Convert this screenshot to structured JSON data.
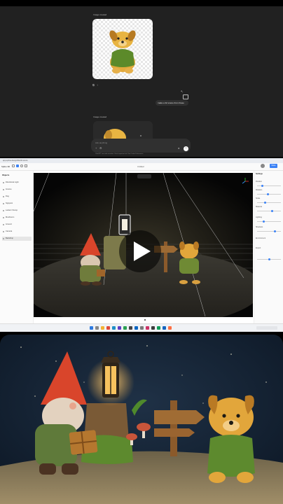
{
  "chat": {
    "top_message_label": "Image created",
    "user_message": "make a 3d scene from these",
    "second_image_label": "Image created",
    "composer_placeholder": "Ask anything",
    "disclaimer": "ChatGPT can make mistakes. Check important info. See Cookie Preferences."
  },
  "editor": {
    "url": "app.spline.design/file/3d-scene",
    "app_name": "Spline 3D",
    "share_label": "Share",
    "scene_title": "Untitled",
    "left_panel_title": "Objects",
    "objects": [
      "Directional Light",
      "Gnome",
      "Dog",
      "Signpost",
      "Lantern Stump",
      "Mushroom",
      "Ground",
      "Camera",
      "Backdrop"
    ],
    "right_panel": {
      "title": "Settings",
      "rows": [
        "Position",
        "Rotation",
        "Scale",
        "Material",
        "Lighting",
        "Shadows",
        "Environment",
        "Export"
      ]
    }
  },
  "icons": {
    "play": "play-icon",
    "send": "arrow-up-icon",
    "plus": "plus-icon",
    "mic": "mic-icon",
    "gizmo": "axis-gizmo-icon"
  },
  "colors": {
    "chat_bg": "#212121",
    "composer_bg": "#303030",
    "accent": "#3b82f6",
    "gnome_hat": "#d9452b",
    "dog_fur": "#e2a63b",
    "sky": "#152335"
  }
}
